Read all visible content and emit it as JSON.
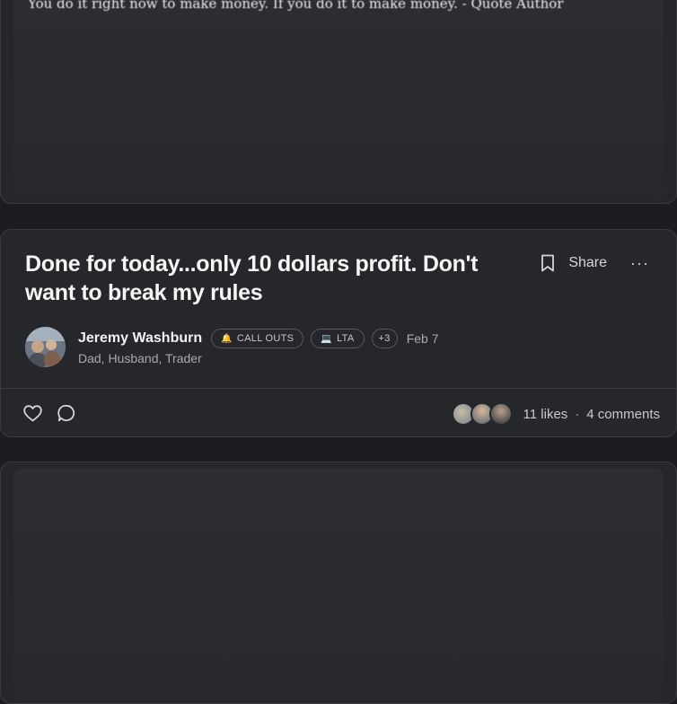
{
  "previous_post": {
    "snippet": "You do it right now to make money. If you do it to make money. - Quote Author"
  },
  "post": {
    "title": "Done for today...only 10 dollars profit. Don't want to break my rules",
    "actions": {
      "bookmark_icon": "bookmark-icon",
      "share_label": "Share",
      "more_label": "···"
    },
    "author": {
      "name": "Jeremy Washburn",
      "bio": "Dad, Husband, Trader"
    },
    "tags": [
      {
        "icon": "🔔",
        "label": "CALL OUTS"
      },
      {
        "icon": "💻",
        "label": "LTA"
      }
    ],
    "more_tags": "+3",
    "date": "Feb 7",
    "footer": {
      "like_icon": "heart-icon",
      "comment_icon": "comment-bubble-icon",
      "likes": "11 likes",
      "separator": "·",
      "comments": "4 comments"
    }
  }
}
